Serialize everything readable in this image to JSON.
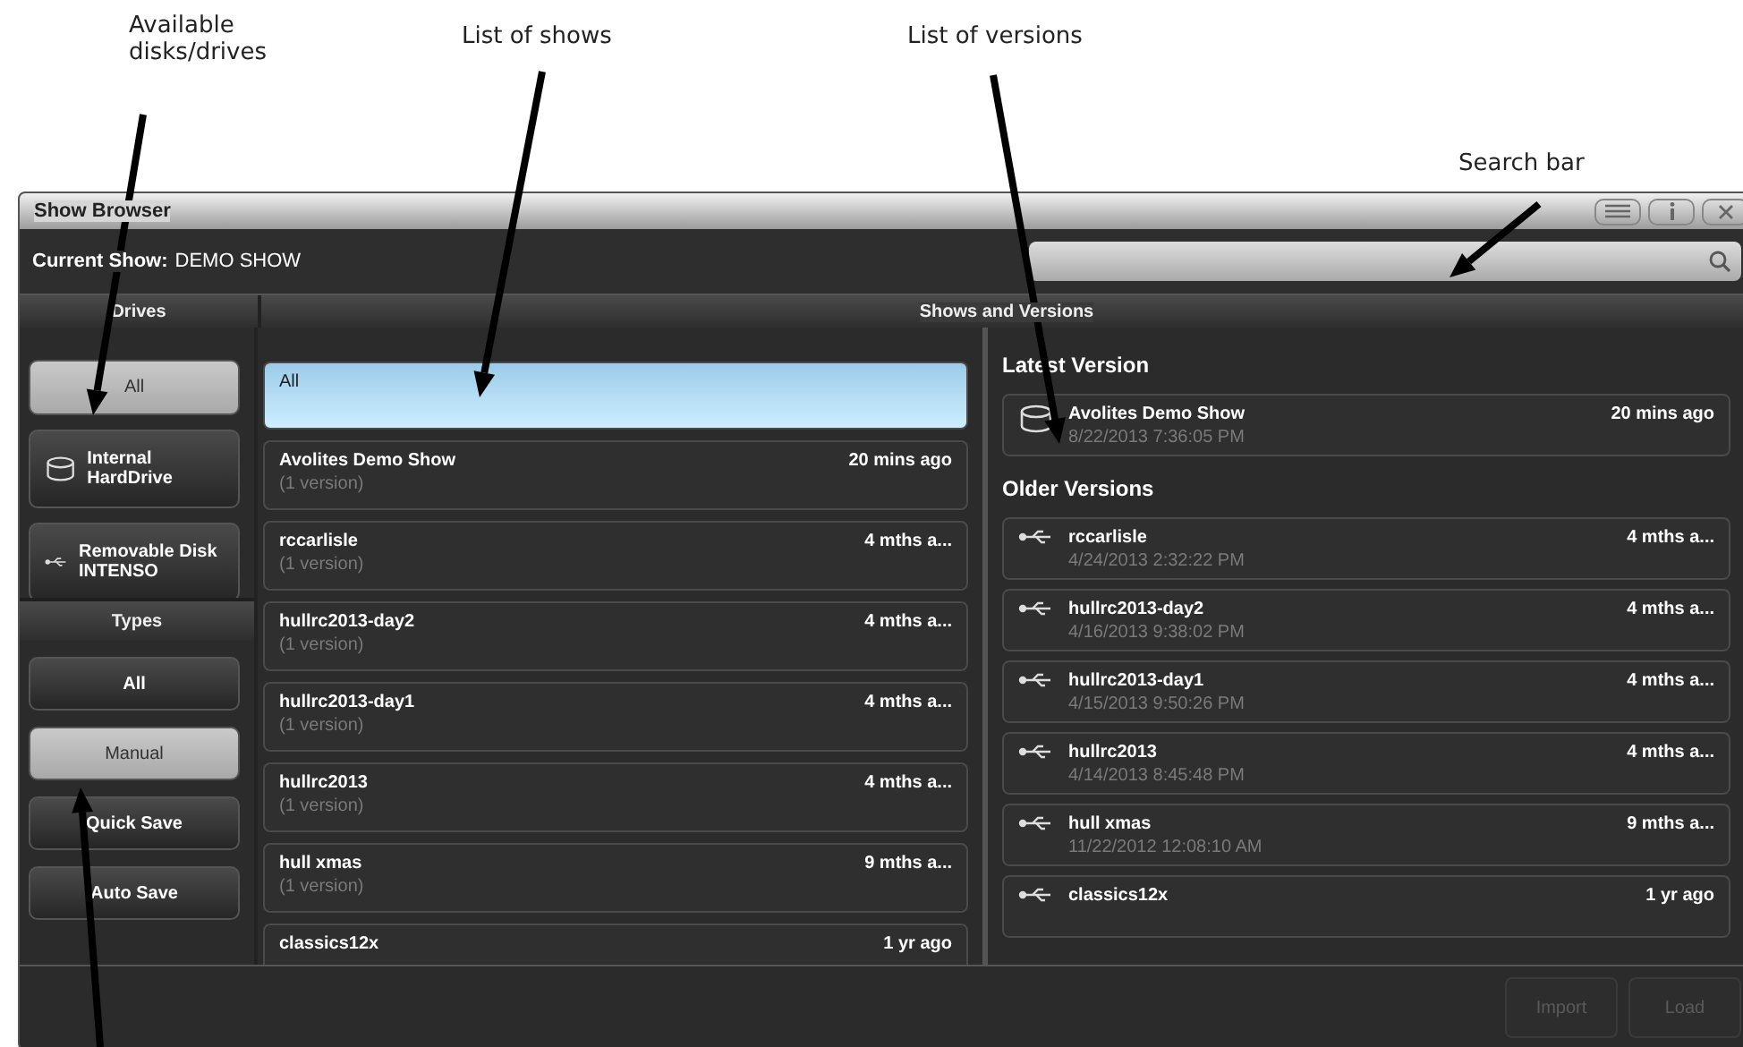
{
  "callouts": [
    {
      "label": "Available disks/drives"
    },
    {
      "label": "List of shows"
    },
    {
      "label": "List of versions"
    },
    {
      "label": "Search bar"
    }
  ],
  "window": {
    "title": "Show Browser",
    "current_show_label": "Current Show:",
    "current_show": "DEMO SHOW"
  },
  "columns": {
    "drives": "Drives",
    "shows_and_versions": "Shows and Versions",
    "types": "Types"
  },
  "drives": [
    {
      "label": "All",
      "kind": "all",
      "selected": true
    },
    {
      "label": "Internal HardDrive",
      "kind": "disk",
      "selected": false
    },
    {
      "label": "Removable Disk INTENSO",
      "kind": "usb",
      "selected": false
    }
  ],
  "types": [
    {
      "label": "All",
      "selected": false
    },
    {
      "label": "Manual",
      "selected": true
    },
    {
      "label": "Quick Save",
      "selected": false
    },
    {
      "label": "Auto Save",
      "selected": false
    }
  ],
  "shows": [
    {
      "name": "All",
      "selected": true
    },
    {
      "name": "Avolites Demo Show",
      "detail": "(1 version)",
      "age": "20 mins ago",
      "selected": false
    },
    {
      "name": "rccarlisle",
      "detail": "(1 version)",
      "age": "4 mths a...",
      "selected": false
    },
    {
      "name": "hullrc2013-day2",
      "detail": "(1 version)",
      "age": "4 mths a...",
      "selected": false
    },
    {
      "name": "hullrc2013-day1",
      "detail": "(1 version)",
      "age": "4 mths a...",
      "selected": false
    },
    {
      "name": "hullrc2013",
      "detail": "(1 version)",
      "age": "4 mths a...",
      "selected": false
    },
    {
      "name": "hull xmas",
      "detail": "(1 version)",
      "age": "9 mths a...",
      "selected": false
    },
    {
      "name": "classics12x",
      "age": "1 yr ago",
      "selected": false
    }
  ],
  "latest_heading": "Latest Version",
  "latest": {
    "name": "Avolites Demo Show",
    "date": "8/22/2013 7:36:05 PM",
    "age": "20 mins ago",
    "kind": "disk",
    "selected": false
  },
  "older_heading": "Older Versions",
  "older": [
    {
      "name": "rccarlisle",
      "date": "4/24/2013 2:32:22 PM",
      "age": "4 mths a...",
      "kind": "usb",
      "selected": false
    },
    {
      "name": "hullrc2013-day2",
      "date": "4/16/2013 9:38:02 PM",
      "age": "4 mths a...",
      "kind": "usb",
      "selected": false
    },
    {
      "name": "hullrc2013-day1",
      "date": "4/15/2013 9:50:26 PM",
      "age": "4 mths a...",
      "kind": "usb",
      "selected": false
    },
    {
      "name": "hullrc2013",
      "date": "4/14/2013 8:45:48 PM",
      "age": "4 mths a...",
      "kind": "usb",
      "selected": false
    },
    {
      "name": "hull xmas",
      "date": "11/22/2012 12:08:10 AM",
      "age": "9 mths a...",
      "kind": "usb",
      "selected": false
    },
    {
      "name": "classics12x",
      "age": "1 yr ago",
      "kind": "usb",
      "selected": false
    }
  ],
  "footer_buttons": [
    {
      "label": "Import",
      "disabled": true
    },
    {
      "label": "Load",
      "disabled": true
    }
  ]
}
